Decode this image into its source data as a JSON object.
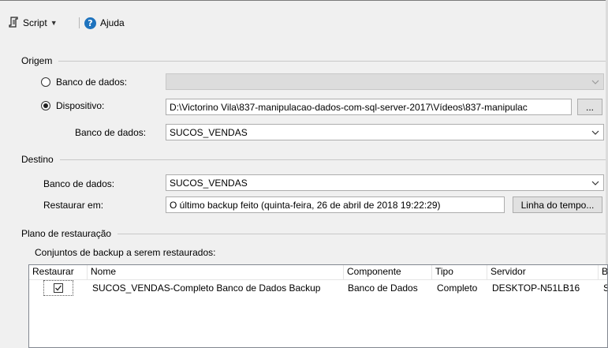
{
  "toolbar": {
    "script_label": "Script",
    "help_label": "Ajuda",
    "help_glyph": "?"
  },
  "origem": {
    "title": "Origem",
    "banco_radio_label": "Banco de dados:",
    "dispositivo_radio_label": "Dispositivo:",
    "dispositivo_path": "D:\\Victorino Vila\\837-manipulacao-dados-com-sql-server-2017\\Vídeos\\837-manipulac",
    "browse_label": "...",
    "db_label": "Banco de dados:",
    "db_value": "SUCOS_VENDAS"
  },
  "destino": {
    "title": "Destino",
    "db_label": "Banco de dados:",
    "db_value": "SUCOS_VENDAS",
    "restore_to_label": "Restaurar em:",
    "restore_to_value": "O último backup feito (quinta-feira, 26 de abril de 2018 19:22:29)",
    "timeline_button": "Linha do tempo..."
  },
  "plano": {
    "title": "Plano de restauração",
    "sets_label": "Conjuntos de backup a serem restaurados:",
    "columns": [
      "Restaurar",
      "Nome",
      "Componente",
      "Tipo",
      "Servidor",
      "B"
    ],
    "rows": [
      {
        "restaurar": true,
        "nome": "SUCOS_VENDAS-Completo Banco de Dados Backup",
        "componente": "Banco de Dados",
        "tipo": "Completo",
        "servidor": "DESKTOP-N51LB16",
        "extra": "S"
      }
    ]
  }
}
